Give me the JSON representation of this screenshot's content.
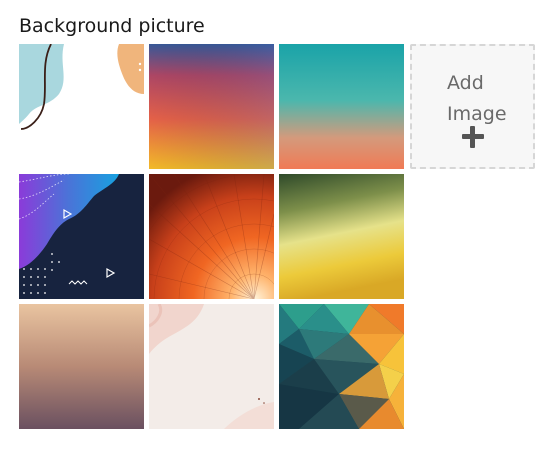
{
  "section": {
    "title": "Background picture"
  },
  "add_image": {
    "label": "Add Image",
    "icon": "plus-icon"
  },
  "backgrounds": [
    {
      "name": "white-abstract-shapes"
    },
    {
      "name": "purple-orange-gradient"
    },
    {
      "name": "teal-peach-gradient"
    },
    {
      "name": "navy-purple-memphis"
    },
    {
      "name": "orange-radial-geometric"
    },
    {
      "name": "green-yellow-gradient"
    },
    {
      "name": "peach-mauve-gradient"
    },
    {
      "name": "pink-watercolor"
    },
    {
      "name": "teal-orange-lowpoly"
    }
  ]
}
